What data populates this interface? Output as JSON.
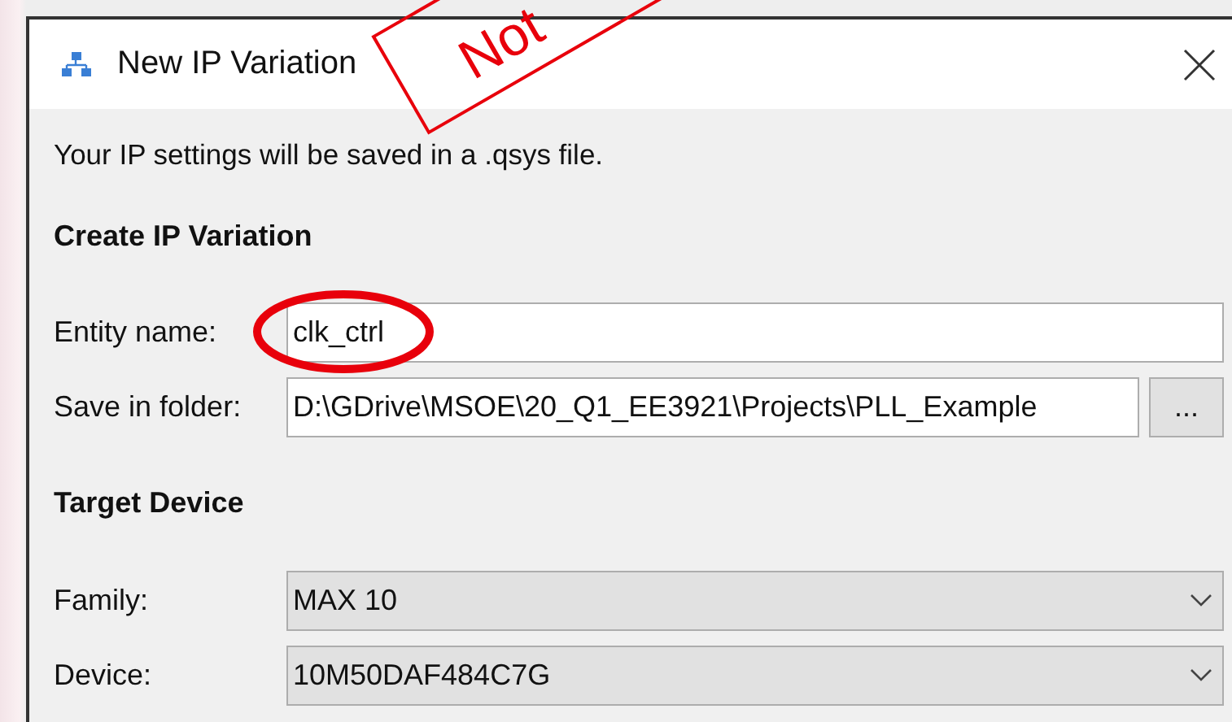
{
  "window": {
    "title": "New IP Variation"
  },
  "info": "Your IP settings will be saved in a .qsys file.",
  "sections": [
    {
      "heading": "Create IP Variation",
      "rows": [
        {
          "kind": "text",
          "label": "Entity name:",
          "value": "clk_ctrl",
          "circled": true
        },
        {
          "kind": "path",
          "label": "Save in folder:",
          "value": "D:\\GDrive\\MSOE\\20_Q1_EE3921\\Projects\\PLL_Example",
          "button": "...",
          "circled": false
        }
      ]
    },
    {
      "heading": "Target Device",
      "rows": [
        {
          "kind": "combo",
          "label": "Family:",
          "value": "MAX 10",
          "circled": false
        },
        {
          "kind": "combo",
          "label": "Device:",
          "value": "10M50DAF484C7G",
          "circled": false
        }
      ]
    }
  ],
  "stamp": {
    "text": "Not"
  }
}
